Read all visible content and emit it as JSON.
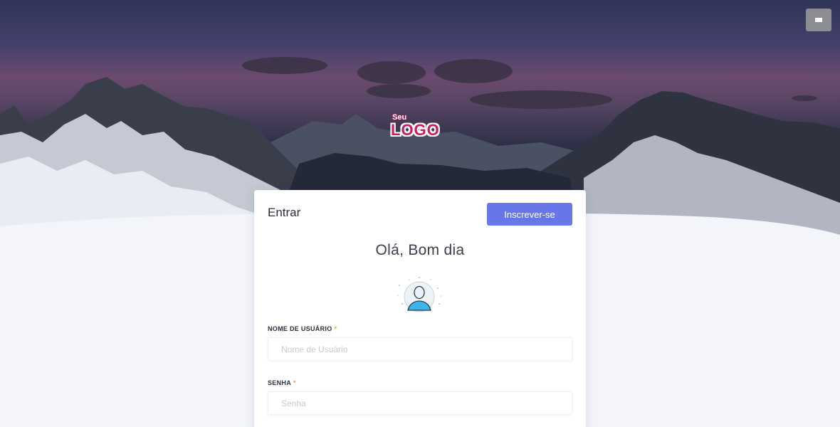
{
  "header": {
    "menu_icon": "hamburger-icon"
  },
  "logo": {
    "small_text": "Seu",
    "big_text": "LOGO",
    "color": "#d0195f"
  },
  "login_card": {
    "title": "Entrar",
    "signup_label": "Inscrever-se",
    "greeting": "Olá, Bom dia",
    "avatar_icon": "user-avatar-icon",
    "fields": [
      {
        "label": "NOME DE USUÁRIO",
        "required_mark": "*",
        "placeholder": "Nome de Usuário",
        "value": ""
      },
      {
        "label": "SENHA",
        "required_mark": "*",
        "placeholder": "Senha",
        "value": ""
      }
    ]
  },
  "colors": {
    "accent": "#6777e8",
    "required": "#f0a23c",
    "background": "#f3f5fa"
  }
}
